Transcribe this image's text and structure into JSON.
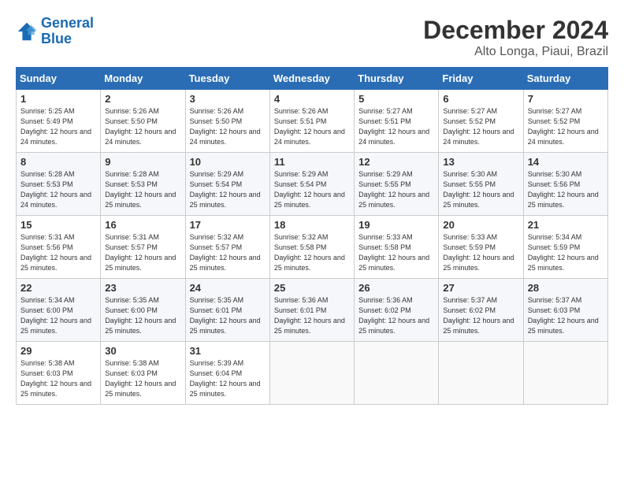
{
  "logo": {
    "line1": "General",
    "line2": "Blue"
  },
  "title": "December 2024",
  "subtitle": "Alto Longa, Piaui, Brazil",
  "headers": [
    "Sunday",
    "Monday",
    "Tuesday",
    "Wednesday",
    "Thursday",
    "Friday",
    "Saturday"
  ],
  "weeks": [
    [
      {
        "day": "1",
        "rise": "5:25 AM",
        "set": "5:49 PM",
        "daylight": "12 hours and 24 minutes."
      },
      {
        "day": "2",
        "rise": "5:26 AM",
        "set": "5:50 PM",
        "daylight": "12 hours and 24 minutes."
      },
      {
        "day": "3",
        "rise": "5:26 AM",
        "set": "5:50 PM",
        "daylight": "12 hours and 24 minutes."
      },
      {
        "day": "4",
        "rise": "5:26 AM",
        "set": "5:51 PM",
        "daylight": "12 hours and 24 minutes."
      },
      {
        "day": "5",
        "rise": "5:27 AM",
        "set": "5:51 PM",
        "daylight": "12 hours and 24 minutes."
      },
      {
        "day": "6",
        "rise": "5:27 AM",
        "set": "5:52 PM",
        "daylight": "12 hours and 24 minutes."
      },
      {
        "day": "7",
        "rise": "5:27 AM",
        "set": "5:52 PM",
        "daylight": "12 hours and 24 minutes."
      }
    ],
    [
      {
        "day": "8",
        "rise": "5:28 AM",
        "set": "5:53 PM",
        "daylight": "12 hours and 24 minutes."
      },
      {
        "day": "9",
        "rise": "5:28 AM",
        "set": "5:53 PM",
        "daylight": "12 hours and 25 minutes."
      },
      {
        "day": "10",
        "rise": "5:29 AM",
        "set": "5:54 PM",
        "daylight": "12 hours and 25 minutes."
      },
      {
        "day": "11",
        "rise": "5:29 AM",
        "set": "5:54 PM",
        "daylight": "12 hours and 25 minutes."
      },
      {
        "day": "12",
        "rise": "5:29 AM",
        "set": "5:55 PM",
        "daylight": "12 hours and 25 minutes."
      },
      {
        "day": "13",
        "rise": "5:30 AM",
        "set": "5:55 PM",
        "daylight": "12 hours and 25 minutes."
      },
      {
        "day": "14",
        "rise": "5:30 AM",
        "set": "5:56 PM",
        "daylight": "12 hours and 25 minutes."
      }
    ],
    [
      {
        "day": "15",
        "rise": "5:31 AM",
        "set": "5:56 PM",
        "daylight": "12 hours and 25 minutes."
      },
      {
        "day": "16",
        "rise": "5:31 AM",
        "set": "5:57 PM",
        "daylight": "12 hours and 25 minutes."
      },
      {
        "day": "17",
        "rise": "5:32 AM",
        "set": "5:57 PM",
        "daylight": "12 hours and 25 minutes."
      },
      {
        "day": "18",
        "rise": "5:32 AM",
        "set": "5:58 PM",
        "daylight": "12 hours and 25 minutes."
      },
      {
        "day": "19",
        "rise": "5:33 AM",
        "set": "5:58 PM",
        "daylight": "12 hours and 25 minutes."
      },
      {
        "day": "20",
        "rise": "5:33 AM",
        "set": "5:59 PM",
        "daylight": "12 hours and 25 minutes."
      },
      {
        "day": "21",
        "rise": "5:34 AM",
        "set": "5:59 PM",
        "daylight": "12 hours and 25 minutes."
      }
    ],
    [
      {
        "day": "22",
        "rise": "5:34 AM",
        "set": "6:00 PM",
        "daylight": "12 hours and 25 minutes."
      },
      {
        "day": "23",
        "rise": "5:35 AM",
        "set": "6:00 PM",
        "daylight": "12 hours and 25 minutes."
      },
      {
        "day": "24",
        "rise": "5:35 AM",
        "set": "6:01 PM",
        "daylight": "12 hours and 25 minutes."
      },
      {
        "day": "25",
        "rise": "5:36 AM",
        "set": "6:01 PM",
        "daylight": "12 hours and 25 minutes."
      },
      {
        "day": "26",
        "rise": "5:36 AM",
        "set": "6:02 PM",
        "daylight": "12 hours and 25 minutes."
      },
      {
        "day": "27",
        "rise": "5:37 AM",
        "set": "6:02 PM",
        "daylight": "12 hours and 25 minutes."
      },
      {
        "day": "28",
        "rise": "5:37 AM",
        "set": "6:03 PM",
        "daylight": "12 hours and 25 minutes."
      }
    ],
    [
      {
        "day": "29",
        "rise": "5:38 AM",
        "set": "6:03 PM",
        "daylight": "12 hours and 25 minutes."
      },
      {
        "day": "30",
        "rise": "5:38 AM",
        "set": "6:03 PM",
        "daylight": "12 hours and 25 minutes."
      },
      {
        "day": "31",
        "rise": "5:39 AM",
        "set": "6:04 PM",
        "daylight": "12 hours and 25 minutes."
      },
      null,
      null,
      null,
      null
    ]
  ]
}
